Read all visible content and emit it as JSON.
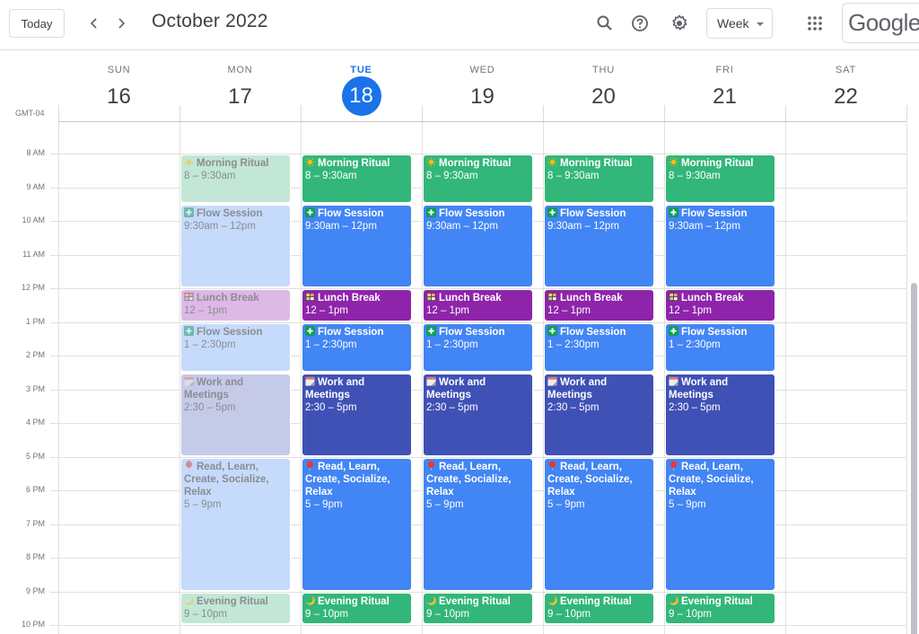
{
  "header": {
    "today_label": "Today",
    "prev_icon": "chevron-left-icon",
    "next_icon": "chevron-right-icon",
    "title": "October 2022",
    "search_icon": "search-icon",
    "help_icon": "help-icon",
    "settings_icon": "gear-icon",
    "view_selected": "Week",
    "apps_icon": "apps-grid-icon",
    "logo_text": "Google"
  },
  "timezone": "GMT-04",
  "days": [
    {
      "dow": "SUN",
      "num": "16",
      "today": false
    },
    {
      "dow": "MON",
      "num": "17",
      "today": false
    },
    {
      "dow": "TUE",
      "num": "18",
      "today": true
    },
    {
      "dow": "WED",
      "num": "19",
      "today": false
    },
    {
      "dow": "THU",
      "num": "20",
      "today": false
    },
    {
      "dow": "FRI",
      "num": "21",
      "today": false
    },
    {
      "dow": "SAT",
      "num": "22",
      "today": false
    }
  ],
  "hours": [
    "8 AM",
    "9 AM",
    "10 AM",
    "11 AM",
    "12 PM",
    "1 PM",
    "2 PM",
    "3 PM",
    "4 PM",
    "5 PM",
    "6 PM",
    "7 PM",
    "8 PM",
    "9 PM",
    "10 PM"
  ],
  "colors": {
    "today_accent": "#1a73e8",
    "morning": "#33b679",
    "flow": "#4285f4",
    "lunch": "#8e24aa",
    "work": "#3f51b5",
    "read": "#4285f4",
    "evening": "#33b679",
    "morning_past": "#c2e7d6",
    "flow_past": "#c6dafc",
    "lunch_past": "#ddb9e6",
    "work_past": "#c5cae9",
    "read_past": "#c6dafc",
    "evening_past": "#c2e7d6"
  },
  "event_template": [
    {
      "key": "morning",
      "icon": "sun-icon",
      "title": "Morning Ritual",
      "time": "8 – 9:30am",
      "start": 8,
      "end": 9.5
    },
    {
      "key": "flow",
      "icon": "sparkle-plus-icon",
      "title": "Flow Session",
      "time": "9:30am – 12pm",
      "start": 9.5,
      "end": 12
    },
    {
      "key": "lunch",
      "icon": "bento-icon",
      "title": "Lunch Break",
      "time": "12 – 1pm",
      "start": 12,
      "end": 13
    },
    {
      "key": "flow",
      "icon": "sparkle-plus-icon",
      "title": "Flow Session",
      "time": "1 – 2:30pm",
      "start": 13,
      "end": 14.5
    },
    {
      "key": "work",
      "icon": "calendar-icon",
      "title": "Work and Meetings",
      "time": "2:30 – 5pm",
      "start": 14.5,
      "end": 17
    },
    {
      "key": "read",
      "icon": "balloon-icon",
      "title": "Read, Learn, Create, Socialize, Relax",
      "time": "5 – 9pm",
      "start": 17,
      "end": 21
    },
    {
      "key": "evening",
      "icon": "moon-icon",
      "title": "Evening Ritual",
      "time": "9 – 10pm",
      "start": 21,
      "end": 22
    }
  ],
  "event_days": [
    {
      "day_index": 1,
      "past": true
    },
    {
      "day_index": 2,
      "past": false
    },
    {
      "day_index": 3,
      "past": false
    },
    {
      "day_index": 4,
      "past": false
    },
    {
      "day_index": 5,
      "past": false
    }
  ]
}
